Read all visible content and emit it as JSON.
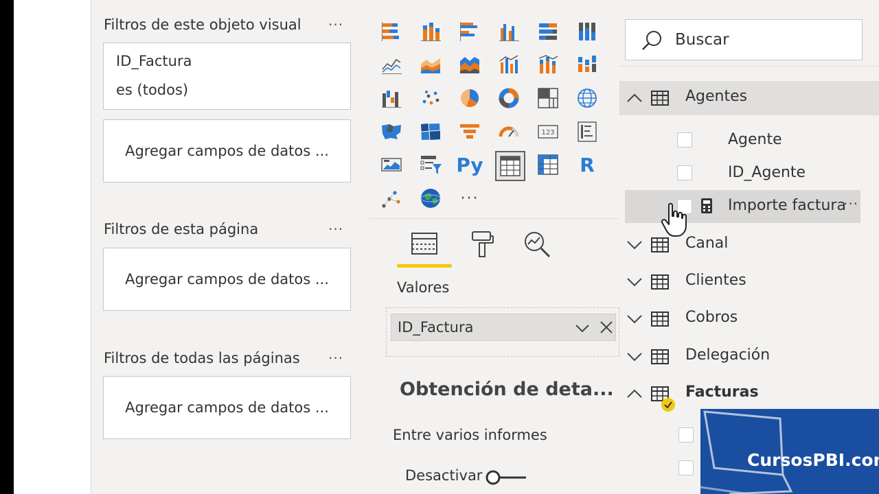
{
  "filters_pane": {
    "visual_section": {
      "title": "Filtros de este objeto visual",
      "more": "···",
      "filter_card": {
        "field": "ID_Factura",
        "condition": "es (todos)"
      },
      "add_fields": "Agregar campos de datos ..."
    },
    "page_section": {
      "title": "Filtros de esta página",
      "more": "···",
      "add_fields": "Agregar campos de datos ..."
    },
    "all_pages_section": {
      "title": "Filtros de todas las páginas",
      "more": "···",
      "add_fields": "Agregar campos de datos ..."
    }
  },
  "visualizations_pane": {
    "gallery": [
      "stacked-bar-chart-icon",
      "stacked-column-chart-icon",
      "clustered-bar-chart-icon",
      "clustered-column-chart-icon",
      "100-stacked-bar-chart-icon",
      "100-stacked-column-chart-icon",
      "line-chart-icon",
      "area-chart-icon",
      "stacked-area-chart-icon",
      "line-clustered-column-chart-icon",
      "line-stacked-column-chart-icon",
      "ribbon-chart-icon",
      "waterfall-chart-icon",
      "scatter-chart-icon",
      "pie-chart-icon",
      "donut-chart-icon",
      "treemap-icon",
      "map-icon",
      "filled-map-icon",
      "shape-map-icon",
      "funnel-icon",
      "gauge-icon",
      "card-icon",
      "multi-row-card-icon",
      "kpi-icon",
      "slicer-icon",
      "python-visual-icon",
      "table-icon",
      "matrix-icon",
      "r-visual-icon",
      "decomposition-tree-icon",
      "arcgis-map-icon",
      "more-visuals-icon"
    ],
    "selected_visual": "table-icon",
    "glyph_python": "Py",
    "glyph_r": "R",
    "more_glyph": "···",
    "tabs": [
      "fields-tab-icon",
      "format-tab-icon",
      "analytics-tab-icon"
    ],
    "active_tab": "fields-tab-icon",
    "well_label": "Valores",
    "well_field": "ID_Factura",
    "drillthrough_title": "Obtención de deta...",
    "drillthrough_sub": "Entre varios informes",
    "toggle_label": "Desactivar",
    "toggle_on": false
  },
  "fields_pane": {
    "search_placeholder": "Buscar",
    "tables": [
      {
        "name": "Agentes",
        "expanded": true
      },
      {
        "name": "Canal",
        "expanded": false
      },
      {
        "name": "Clientes",
        "expanded": false
      },
      {
        "name": "Cobros",
        "expanded": false
      },
      {
        "name": "Delegación",
        "expanded": false
      },
      {
        "name": "Facturas",
        "expanded": true
      }
    ],
    "agentes_fields": [
      {
        "name": "Agente",
        "checked": false
      },
      {
        "name": "ID_Agente",
        "checked": false
      },
      {
        "name": "Importe factura",
        "checked": false,
        "type": "measure",
        "more": "···"
      }
    ]
  },
  "colors": {
    "accent_yellow": "#f2c811",
    "chart_blue": "#2b7cd3",
    "chart_orange": "#e8791c",
    "watermark_blue": "#1a4ea0"
  },
  "watermark": {
    "text": "CursosPBI.com"
  }
}
